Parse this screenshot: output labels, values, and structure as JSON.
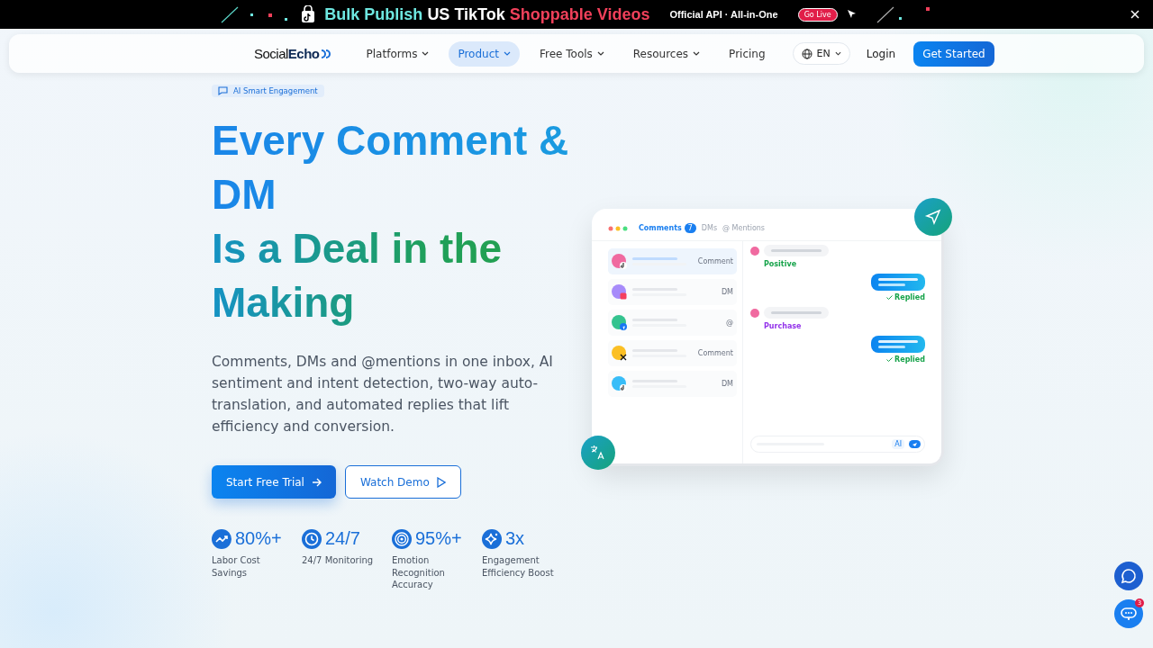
{
  "banner": {
    "headline": [
      {
        "text": "Bulk Publish",
        "color": "#6ee7e0"
      },
      {
        "text": "US TikTok",
        "color": "#ffffff"
      },
      {
        "text": "Shoppable Videos",
        "color": "#f0405a"
      }
    ],
    "tagline": "Official API · All-in-One",
    "badge": "Go Live"
  },
  "nav": {
    "logo_plain": "Social",
    "logo_bold": "Echo",
    "items": [
      {
        "label": "Platforms",
        "dropdown": true,
        "selected": false
      },
      {
        "label": "Product",
        "dropdown": true,
        "selected": true
      },
      {
        "label": "Free Tools",
        "dropdown": true,
        "selected": false
      },
      {
        "label": "Resources",
        "dropdown": true,
        "selected": false
      },
      {
        "label": "Pricing",
        "dropdown": false,
        "selected": false
      }
    ],
    "language": "EN",
    "login": "Login",
    "cta": "Get Started"
  },
  "hero": {
    "tag": "AI Smart Engagement",
    "title_line_1": "Every Comment & DM",
    "title_line_2": "Is a Deal in the Making",
    "description": "Comments, DMs and @mentions in one inbox, AI sentiment and intent detection, two-way auto-translation, and automated replies that lift efficiency and conversion.",
    "primary_button": "Start Free Trial",
    "secondary_button": "Watch Demo",
    "stats": [
      {
        "kind": "trend",
        "value": "80%+",
        "label": "Labor Cost Savings"
      },
      {
        "kind": "clock",
        "value": "24/7",
        "label": "24/7 Monitoring"
      },
      {
        "kind": "target",
        "value": "95%+",
        "label": "Emotion Recognition Accuracy"
      },
      {
        "kind": "sparkle",
        "value": "3x",
        "label": "Engagement Efficiency Boost"
      }
    ]
  },
  "mockup": {
    "tabs": [
      {
        "label": "Comments",
        "count": "7",
        "selected": true
      },
      {
        "label": "DMs",
        "selected": false
      },
      {
        "label": "@ Mentions",
        "selected": false
      }
    ],
    "conversations": [
      {
        "color": "#f06aa0",
        "kind": "tiktok",
        "tag": "Comment",
        "selected": true
      },
      {
        "color": "#a78bfa",
        "kind": "instagram",
        "tag": "DM",
        "selected": false
      },
      {
        "color": "#34c38f",
        "kind": "facebook",
        "tag": "@",
        "selected": false
      },
      {
        "color": "#fbbf24",
        "kind": "x",
        "tag": "Comment",
        "selected": false
      },
      {
        "color": "#38bdf8",
        "kind": "tiktok",
        "tag": "DM",
        "selected": false
      }
    ],
    "messages": [
      {
        "kind": "incoming",
        "label": "Positive",
        "color": "#16a34a"
      },
      {
        "kind": "outgoing",
        "label": "Replied",
        "color": "#16a34a"
      },
      {
        "kind": "incoming",
        "label": "Purchase",
        "color": "#9333ea"
      },
      {
        "kind": "outgoing",
        "label": "Replied",
        "color": "#16a34a"
      }
    ],
    "ai_button": "AI"
  },
  "chat_widget": {
    "unread": "3"
  }
}
